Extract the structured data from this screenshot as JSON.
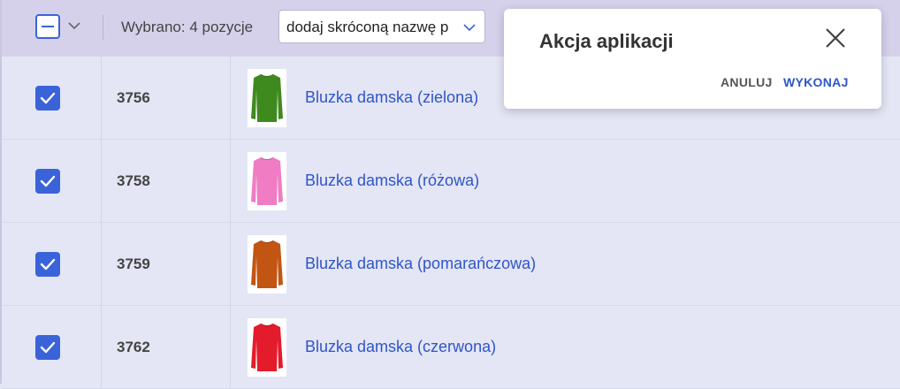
{
  "toolbar": {
    "selected_text": "Wybrano: 4 pozycje",
    "action_select_value": "dodaj skróconą nazwę p"
  },
  "rows": [
    {
      "id": "3756",
      "name": "Bluzka damska (zielona)",
      "checked": true,
      "color": "#3f8a1f"
    },
    {
      "id": "3758",
      "name": "Bluzka damska (różowa)",
      "checked": true,
      "color": "#f07cc4"
    },
    {
      "id": "3759",
      "name": "Bluzka damska (pomarańczowa)",
      "checked": true,
      "color": "#c25512"
    },
    {
      "id": "3762",
      "name": "Bluzka damska (czerwona)",
      "checked": true,
      "color": "#e31b2b"
    }
  ],
  "dialog": {
    "title": "Akcja aplikacji",
    "cancel_label": "ANULUJ",
    "execute_label": "WYKONAJ"
  },
  "colors": {
    "accent": "#3b63d9",
    "link": "#2e55c9",
    "toolbar_bg": "#d6d1ea",
    "table_bg": "#e4e6f5"
  },
  "icons": {
    "bulk_check": "minus-checkbox-icon",
    "dropdown": "chevron-down-icon",
    "row_check": "checkmark-icon",
    "close": "close-icon"
  }
}
